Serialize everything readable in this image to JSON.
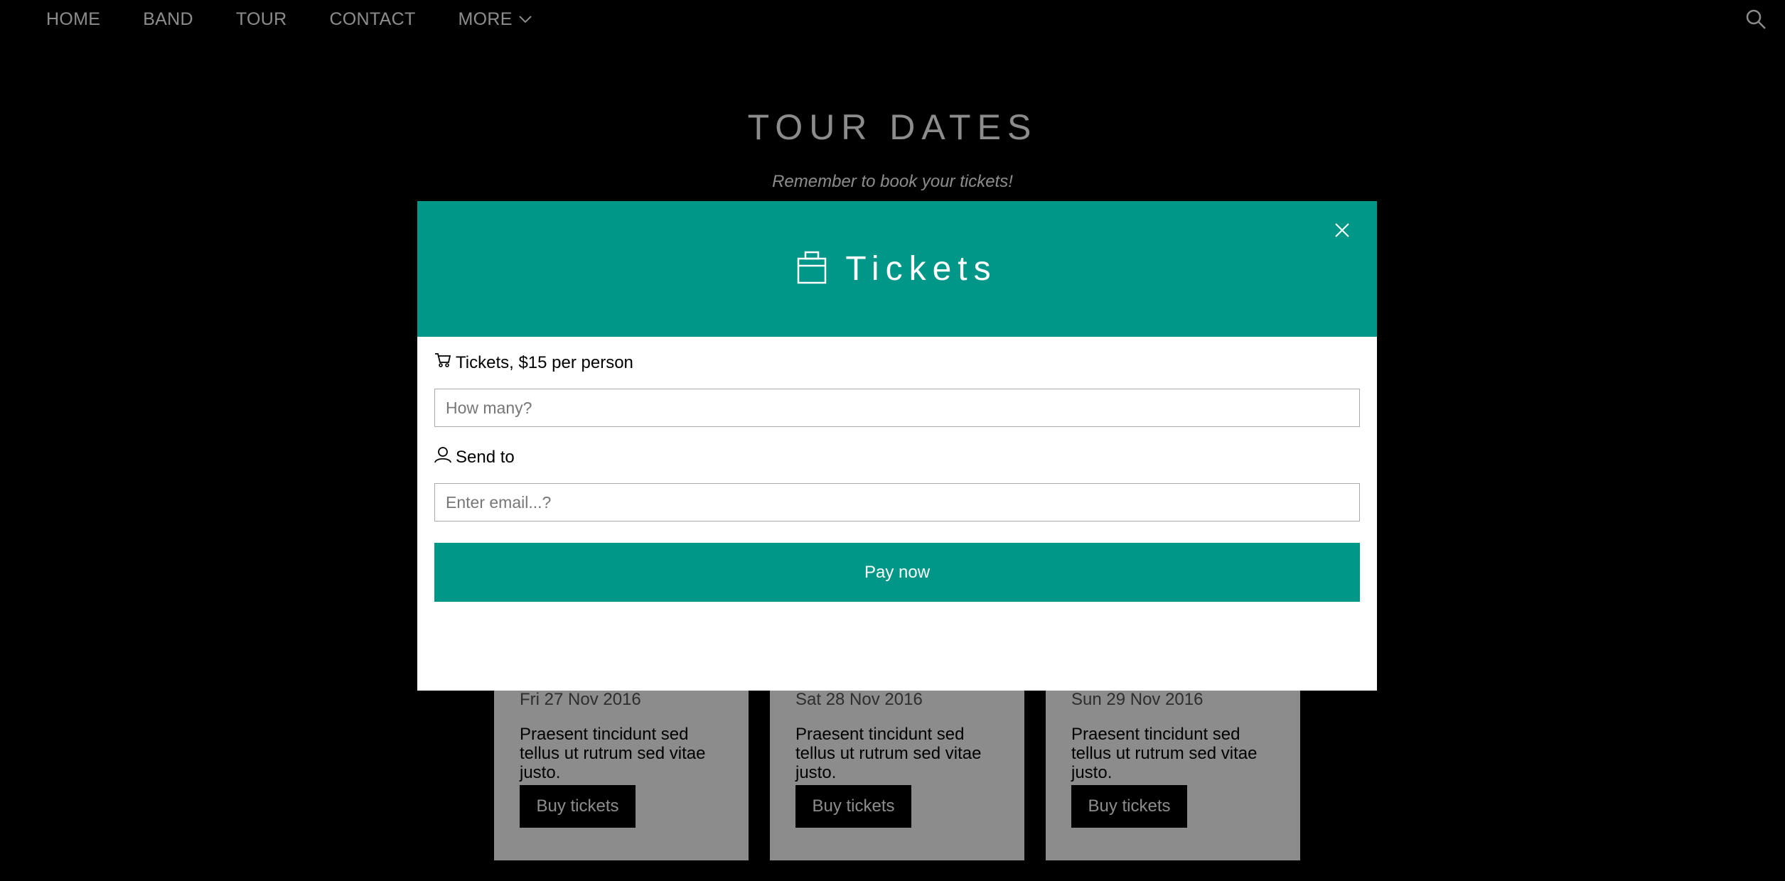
{
  "nav": {
    "items": [
      "HOME",
      "BAND",
      "TOUR",
      "CONTACT"
    ],
    "more_label": "MORE",
    "search_icon": "search-icon"
  },
  "tour": {
    "title": "TOUR DATES",
    "subtitle": "Remember to book your tickets!",
    "cards": [
      {
        "date": "Fri 27 Nov 2016",
        "desc": "Praesent tincidunt sed tellus ut rutrum sed vitae justo.",
        "button": "Buy tickets"
      },
      {
        "date": "Sat 28 Nov 2016",
        "desc": "Praesent tincidunt sed tellus ut rutrum sed vitae justo.",
        "button": "Buy tickets"
      },
      {
        "date": "Sun 29 Nov 2016",
        "desc": "Praesent tincidunt sed tellus ut rutrum sed vitae justo.",
        "button": "Buy tickets"
      }
    ]
  },
  "modal": {
    "title": "Tickets",
    "title_icon": "briefcase-icon",
    "tickets_label": "Tickets, $15 per person",
    "tickets_icon": "cart-icon",
    "quantity_placeholder": "How many?",
    "send_label": "Send to",
    "send_icon": "user-icon",
    "email_placeholder": "Enter email...?",
    "pay_label": "Pay now"
  },
  "colors": {
    "accent": "#009688",
    "background": "#000000",
    "overlay": "rgba(0,0,0,0.45)"
  }
}
